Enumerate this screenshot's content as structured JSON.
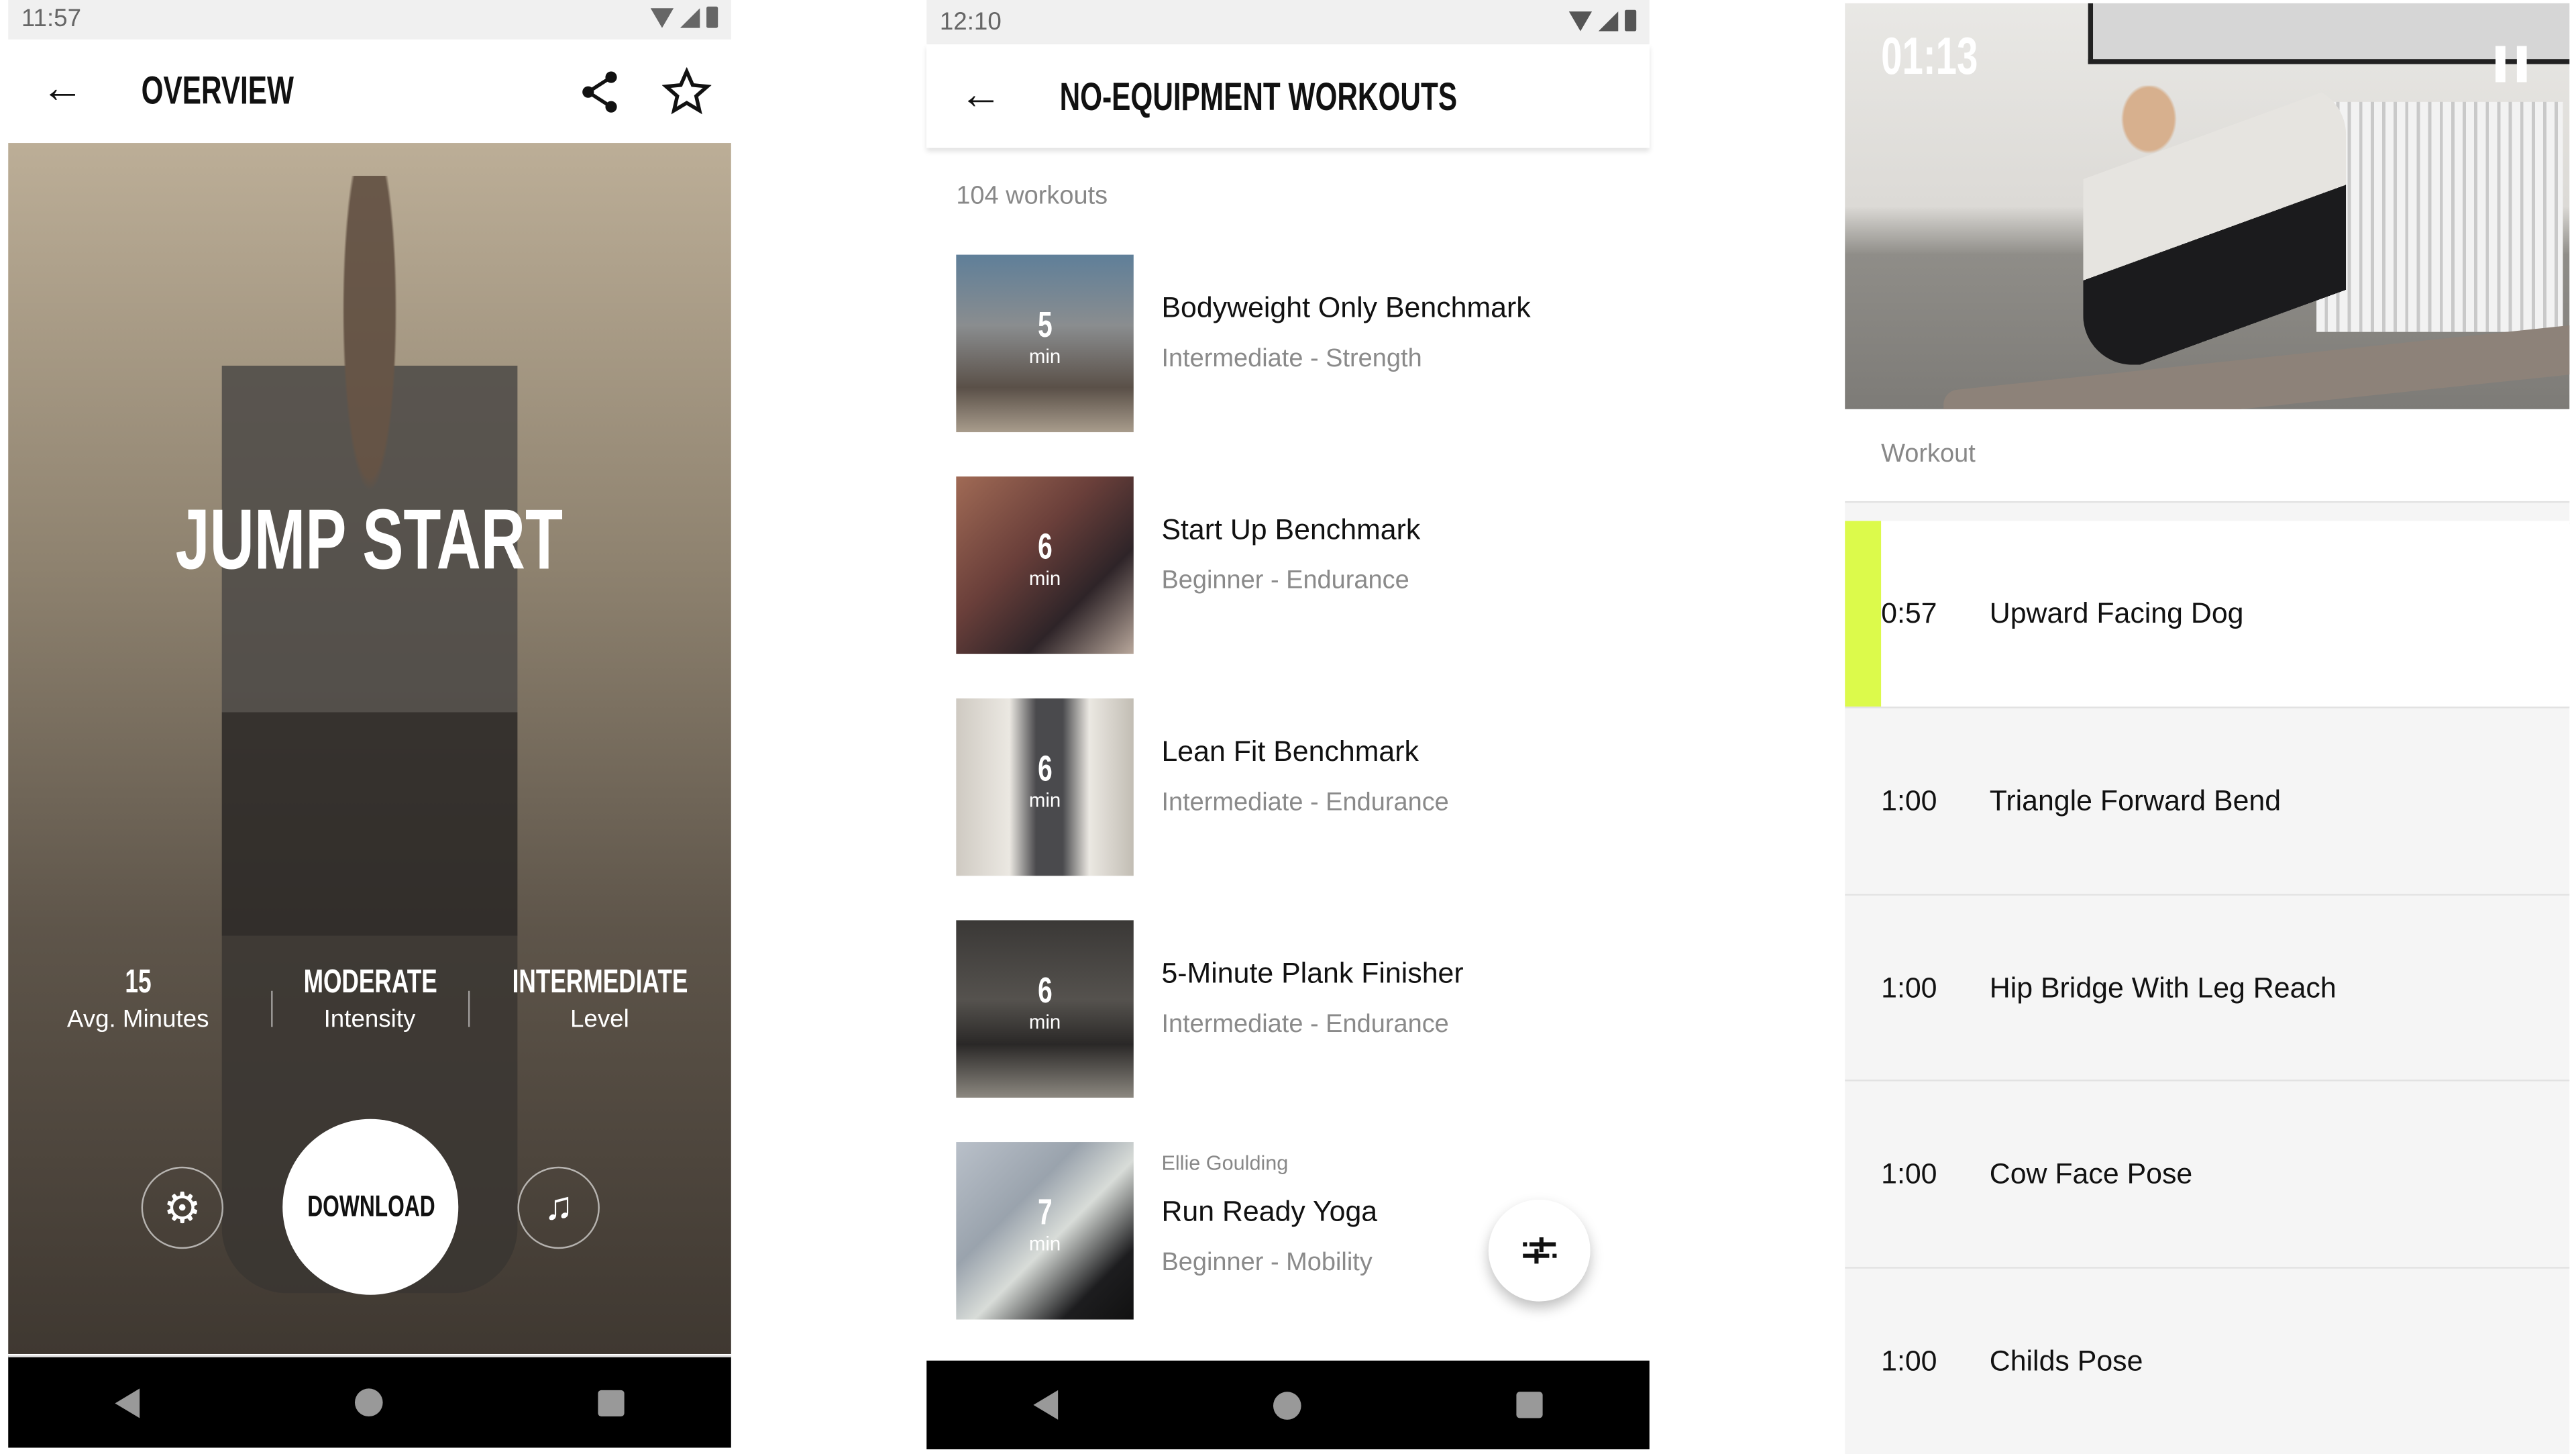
{
  "overview": {
    "status_time": "11:57",
    "title": "OVERVIEW",
    "hero_title": "JUMP START",
    "stats": [
      {
        "value": "15",
        "label": "Avg. Minutes"
      },
      {
        "value": "MODERATE",
        "label": "Intensity"
      },
      {
        "value": "INTERMEDIATE",
        "label": "Level"
      }
    ],
    "download_label": "DOWNLOAD",
    "icons": [
      "back-arrow-icon",
      "share-icon",
      "star-outline-icon",
      "gear-icon",
      "music-note-icon"
    ]
  },
  "workouts": {
    "status_time": "12:10",
    "title": "NO-EQUIPMENT WORKOUTS",
    "count": "104 workouts",
    "items": [
      {
        "minutes": "5",
        "unit": "min",
        "artist": "",
        "title": "Bodyweight Only Benchmark",
        "subtitle": "Intermediate - Strength"
      },
      {
        "minutes": "6",
        "unit": "min",
        "artist": "",
        "title": "Start Up Benchmark",
        "subtitle": "Beginner - Endurance"
      },
      {
        "minutes": "6",
        "unit": "min",
        "artist": "",
        "title": "Lean Fit Benchmark",
        "subtitle": "Intermediate - Endurance"
      },
      {
        "minutes": "6",
        "unit": "min",
        "artist": "",
        "title": "5-Minute Plank Finisher",
        "subtitle": "Intermediate - Endurance"
      },
      {
        "minutes": "7",
        "unit": "min",
        "artist": "Ellie Goulding",
        "title": "Run Ready Yoga",
        "subtitle": "Beginner - Mobility"
      }
    ],
    "filter_icon": "sliders-icon"
  },
  "player": {
    "timer": "01:13",
    "section_label": "Workout",
    "accent_color": "#dcfa4b",
    "exercises": [
      {
        "time": "0:57",
        "name": "Upward Facing Dog",
        "active": true
      },
      {
        "time": "1:00",
        "name": "Triangle Forward Bend",
        "active": false
      },
      {
        "time": "1:00",
        "name": "Hip Bridge With Leg Reach",
        "active": false
      },
      {
        "time": "1:00",
        "name": "Cow Face Pose",
        "active": false
      },
      {
        "time": "1:00",
        "name": "Childs Pose",
        "active": false
      }
    ]
  }
}
